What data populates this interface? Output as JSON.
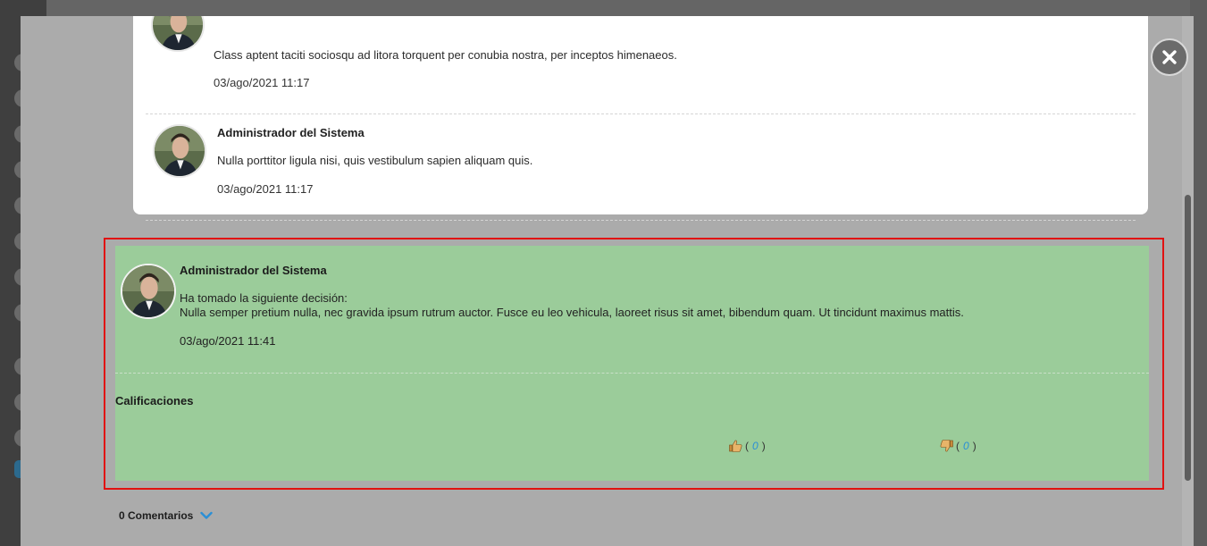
{
  "modal": {
    "close_icon": "close-icon",
    "comments": [
      {
        "author": "",
        "body": "Class aptent taciti sociosqu ad litora torquent per conubia nostra, per inceptos himenaeos.",
        "date": "03/ago/2021 11:17"
      },
      {
        "author": "Administrador del Sistema",
        "body": "Nulla porttitor ligula nisi, quis vestibulum sapien aliquam quis.",
        "date": "03/ago/2021 11:17"
      }
    ],
    "decision": {
      "author": "Administrador del Sistema",
      "intro": "Ha tomado la siguiente decisión:",
      "text": "Nulla semper pretium nulla, nec gravida ipsum rutrum auctor. Fusce eu leo vehicula, laoreet risus sit amet, bibendum quam. Ut tincidunt maximus mattis.",
      "date": "03/ago/2021 11:41",
      "ratings_title": "Calificaciones",
      "likes": "0",
      "dislikes": "0",
      "highlight_color": "#9bcc9a",
      "frame_color": "#e11111"
    },
    "comments_toggle_label": "0 Comentarios"
  }
}
